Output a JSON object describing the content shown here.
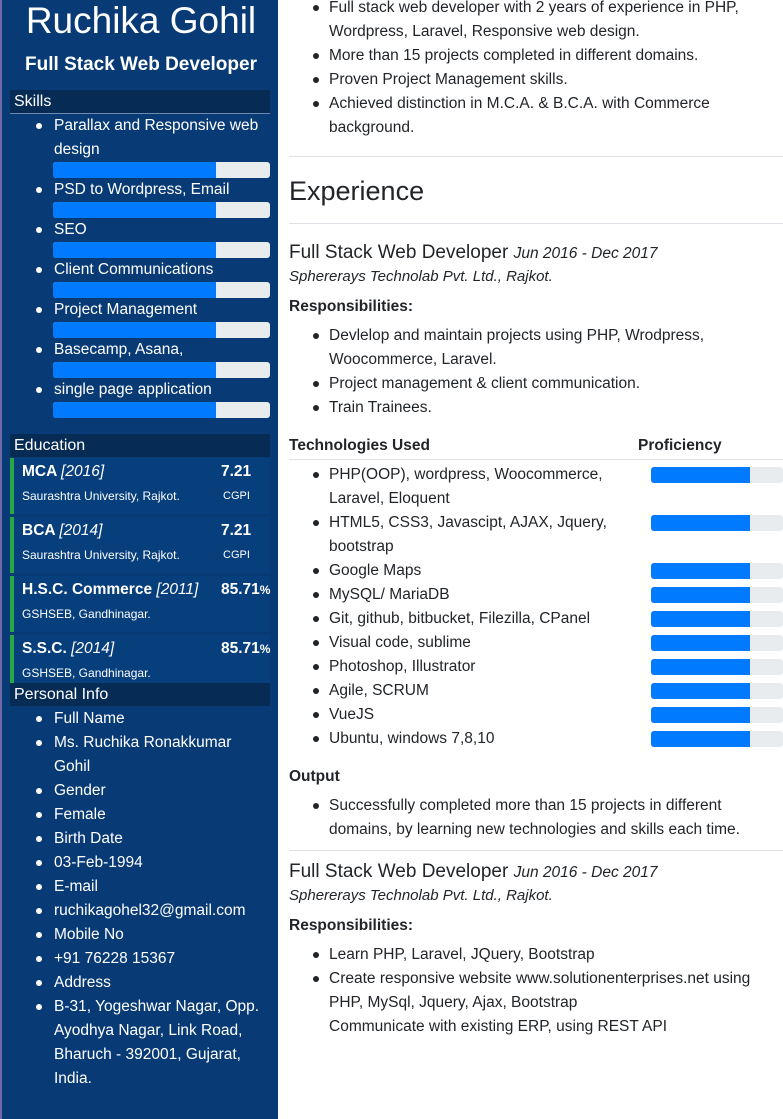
{
  "sidebar": {
    "name": "Ruchika Gohil",
    "role": "Full Stack Web Developer",
    "skills_heading": "Skills",
    "skills": [
      {
        "label_lines": [
          "Parallax and Responsive web",
          "design"
        ],
        "level": 0.75
      },
      {
        "label_lines": [
          "PSD to Wordpress, Email"
        ],
        "level": 0.75
      },
      {
        "label_lines": [
          "SEO"
        ],
        "level": 0.75
      },
      {
        "label_lines": [
          "Client Communications"
        ],
        "level": 0.75
      },
      {
        "label_lines": [
          "Project Management"
        ],
        "level": 0.75
      },
      {
        "label_lines": [
          "Basecamp, Asana,"
        ],
        "level": 0.75
      },
      {
        "label_lines": [
          "single page application"
        ],
        "level": 0.75
      }
    ],
    "education_heading": "Education",
    "education": [
      {
        "degree": "MCA",
        "year": "[2016]",
        "institution": "Saurashtra University, Rajkot.",
        "score": "7.21",
        "score_suffix": "",
        "unit": "CGPI"
      },
      {
        "degree": "BCA",
        "year": "[2014]",
        "institution": "Saurashtra University, Rajkot.",
        "score": "7.21",
        "score_suffix": "",
        "unit": "CGPI"
      },
      {
        "degree": "H.S.C. Commerce",
        "year": "[2011]",
        "institution": "GSHSEB, Gandhinagar.",
        "score": "85.71",
        "score_suffix": "%",
        "unit": ""
      },
      {
        "degree": "S.S.C.",
        "year": "[2014]",
        "institution": "GSHSEB, Gandhinagar.",
        "score": "85.71",
        "score_suffix": "%",
        "unit": ""
      }
    ],
    "personal_heading": "Personal Info",
    "personal": [
      {
        "lines": [
          "Full Name"
        ]
      },
      {
        "lines": [
          "Ms. Ruchika Ronakkumar",
          "Gohil"
        ]
      },
      {
        "lines": [
          "Gender"
        ]
      },
      {
        "lines": [
          "Female"
        ]
      },
      {
        "lines": [
          "Birth Date"
        ]
      },
      {
        "lines": [
          "03-Feb-1994"
        ]
      },
      {
        "lines": [
          "E-mail"
        ]
      },
      {
        "lines": [
          "ruchikagohel32@gmail.com"
        ]
      },
      {
        "lines": [
          "Mobile No"
        ]
      },
      {
        "lines": [
          "+91 76228 15367"
        ]
      },
      {
        "lines": [
          "Address"
        ]
      },
      {
        "lines": [
          "B-31, Yogeshwar Nagar, Opp.",
          "Ayodhya Nagar, Link Road,",
          "Bharuch - 392001, Gujarat,",
          "India."
        ]
      }
    ]
  },
  "main": {
    "summary": [
      {
        "lines": [
          "Full stack web developer with 2 years of experience in PHP,",
          "Wordpress, Laravel, Responsive web design."
        ]
      },
      {
        "lines": [
          "More than 15 projects completed in different domains."
        ]
      },
      {
        "lines": [
          "Proven Project Management skills."
        ]
      },
      {
        "lines": [
          "Achieved distinction in M.C.A. & B.C.A. with Commerce",
          "background."
        ]
      }
    ],
    "experience_heading": "Experience",
    "jobs": [
      {
        "title": "Full Stack Web Developer",
        "date": "Jun 2016 - Dec 2017",
        "company": "Sphererays Technolab Pvt. Ltd., Rajkot.",
        "responsibilities_heading": "Responsibilities:",
        "responsibilities": [
          {
            "lines": [
              "Devlelop and maintain projects using PHP, Wrodpress,",
              "Woocommerce, Laravel."
            ]
          },
          {
            "lines": [
              "Project management & client communication."
            ]
          },
          {
            "lines": [
              "Train Trainees."
            ]
          }
        ],
        "technologies_heading": "Technologies Used",
        "proficiency_heading": "Proficiency",
        "technologies": [
          {
            "lines": [
              "PHP(OOP), wordpress, Woocommerce,",
              "Laravel, Eloquent"
            ],
            "level": 0.75
          },
          {
            "lines": [
              "HTML5, CSS3, Javascipt, AJAX, Jquery,",
              "bootstrap"
            ],
            "level": 0.75
          },
          {
            "lines": [
              "Google Maps"
            ],
            "level": 0.75
          },
          {
            "lines": [
              "MySQL/ MariaDB"
            ],
            "level": 0.75
          },
          {
            "lines": [
              "Git, github, bitbucket, Filezilla, CPanel"
            ],
            "level": 0.75
          },
          {
            "lines": [
              "Visual code, sublime"
            ],
            "level": 0.75
          },
          {
            "lines": [
              "Photoshop, Illustrator"
            ],
            "level": 0.75
          },
          {
            "lines": [
              "Agile, SCRUM"
            ],
            "level": 0.75
          },
          {
            "lines": [
              "VueJS"
            ],
            "level": 0.75
          },
          {
            "lines": [
              "Ubuntu, windows 7,8,10"
            ],
            "level": 0.75
          }
        ],
        "output_heading": "Output",
        "output": [
          {
            "lines": [
              "Successfully completed more than 15 projects in different",
              "domains, by learning new technologies and skills each time."
            ]
          }
        ]
      },
      {
        "title": "Full Stack Web Developer",
        "date": "Jun 2016 - Dec 2017",
        "company": "Sphererays Technolab Pvt. Ltd., Rajkot.",
        "responsibilities_heading": "Responsibilities:",
        "responsibilities": [
          {
            "lines": [
              "Learn PHP, Laravel, JQuery, Bootstrap"
            ]
          },
          {
            "lines": [
              "Create responsive website www.solutionenterprises.net using",
              "PHP, MySql, Jquery, Ajax, Bootstrap",
              "Communicate with existing ERP, using REST API"
            ]
          }
        ]
      }
    ]
  }
}
